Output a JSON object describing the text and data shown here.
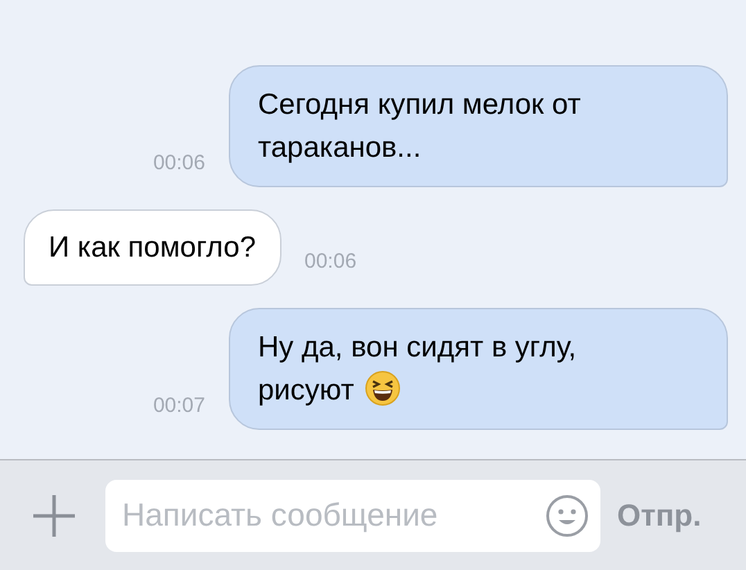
{
  "messages": [
    {
      "kind": "outgoing",
      "text": "Сегодня купил мелок от тараканов...",
      "time": "00:06",
      "emoji": false
    },
    {
      "kind": "incoming",
      "text": "И как помогло?",
      "time": "00:06",
      "emoji": false
    },
    {
      "kind": "outgoing",
      "text": "Ну да, вон сидят в углу, рисуют",
      "time": "00:07",
      "emoji": true
    }
  ],
  "composer": {
    "placeholder": "Написать сообщение",
    "send": "Отпр."
  }
}
